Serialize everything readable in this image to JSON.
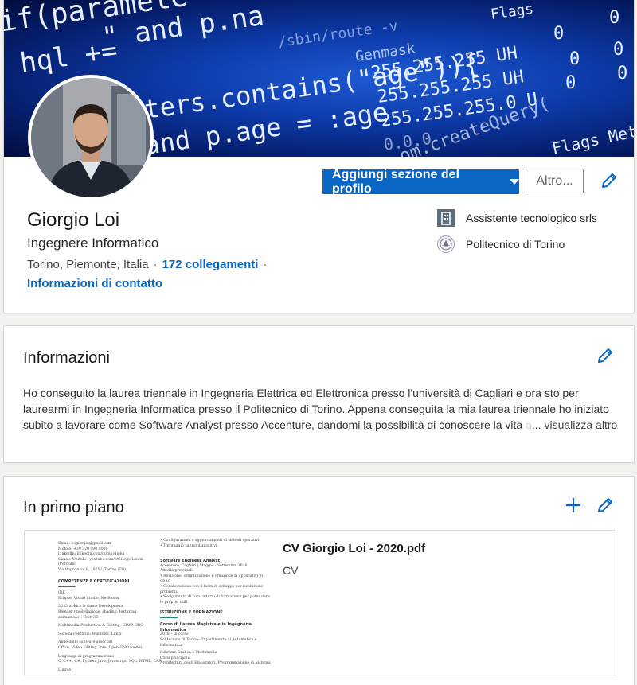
{
  "profile": {
    "name": "Giorgio Loi",
    "headline": "Ingegnere Informatico",
    "location": "Torino, Piemonte, Italia",
    "connections": "172 collegamenti",
    "contact_info": "Informazioni di contatto",
    "add_section_button": "Aggiungi sezione del profilo",
    "more_button": "Altro...",
    "banner_code": {
      "line1": "if(paramete",
      "line2": "hql +=",
      "line3": "\" and p.na",
      "line4": "/sbin/route -v",
      "line5": "ters.contains(\"age\")){",
      "line6": "Genmask",
      "line7": "and p.age = :age",
      "line8": "255.255.255 UH",
      "line9": "255.255.255 UH",
      "line10": "255.255.255.0  U",
      "line11": "0.0.0",
      "line12": "om.createQuery(",
      "line13": "Flags Metric",
      "line14": "Flags"
    },
    "experience": [
      {
        "name": "Assistente tecnologico srls",
        "icon": "building-icon"
      },
      {
        "name": "Politecnico di Torino",
        "icon": "university-seal-icon"
      }
    ]
  },
  "about": {
    "title": "Informazioni",
    "text": "Ho conseguito la laurea triennale in Ingegneria Elettrica ed Elettronica presso l'università di Cagliari e ora sto per laurearmi in Ingegneria Informatica presso il Politecnico di Torino. Appena conseguita la mia laurea triennale ho iniziato subito a lavorare come Software Analyst presso Accenture, dandomi la possibilità di conoscere la vita",
    "fade_text": " a",
    "more_link": "... visualizza altro"
  },
  "featured": {
    "title": "In primo piano",
    "item": {
      "title": "CV Giorgio Loi - 2020.pdf",
      "subtitle": "CV",
      "doc_left": {
        "contact": [
          "Email: loigiorgio@gmail.com",
          "Mobile: +39 320 000 0000",
          "LinkedIn: linkedin.com/in/giorgioloi",
          "Canale Youtube: youtube.com/c/GiorgioLoiam (Portfolio)",
          "Via Bognanco, 8, 10152, Torino (TO)"
        ],
        "section": "COMPETENZE E CERTIFICAZIONI",
        "skills": [
          "IDE",
          "Eclipse, Visual Studio, NetBeans",
          "",
          "3D Graphics & Game Development",
          "Blender (modellazione, shading, texturing, animazione), Unity3D",
          "",
          "Multimedia Production & Editing: GIMP, OBS",
          "",
          "Sistemi operativi: Windows, Linux",
          "",
          "Abile dello software associati",
          "Office, Video Editing, Intel OpenVINO toolkit",
          "",
          "Linguaggi di programmazione",
          "C, C++, C#, Python, Java, Javascript, SQL, HTML, CSS",
          "",
          "Lingue"
        ]
      },
      "doc_right": {
        "top": [
          "• Configurazioni e aggiornamenti di sistemi operativi.",
          "• Tutoraggio su uso dispositivi."
        ],
        "job_title": "Software Engineer Analyst",
        "job_meta": "Accenture, Cagliari | Maggio - Settembre 2016",
        "job_items": [
          "Attività principali:",
          "• Revisione, ottimizzazione e creazione di applicativi in SBAP.",
          "• Collaborazione con il team di sviluppo per risoluzione problemi.",
          "• Svolgimento di corsi interni di formazione per potenziare le proprie skill."
        ],
        "section": "ISTRUZIONE E FORMAZIONE",
        "degree": "Corso di Laurea Magistrale in Ingegneria Informatica",
        "degree_items": [
          "2018 – in corso",
          "Politecnico di Torino - Dipartimento di Automatica e Informatica",
          "",
          "Indirizzo Grafica e Multimedia",
          "Corsi principali:",
          "Architettura degli Elaboratori, Programmazione di Sistema."
        ]
      }
    }
  },
  "colors": {
    "accent": "#0a66c2",
    "banner": "#0d3aa8",
    "background": "#f3f2ef"
  }
}
